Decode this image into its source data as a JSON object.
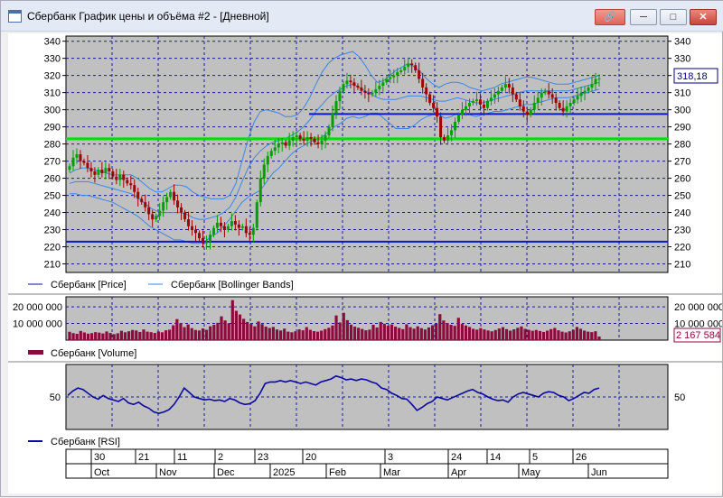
{
  "window": {
    "title": "Сбербанк График цены и объёма #2 - [Дневной]",
    "icons": [
      "app-icon",
      "link-icon",
      "minimize-icon",
      "maximize-icon",
      "close-icon"
    ]
  },
  "colors": {
    "background": "#c0c0c0",
    "grid": "#1a1aa0",
    "candle_up": "#00a000",
    "candle_down": "#a00000",
    "bands": "#3b86e8",
    "volume": "#8c0a3c",
    "rsi": "#0a0aa0",
    "support_green": "#00e000",
    "support_blue": "#0a18c8"
  },
  "chart_data": [
    {
      "type": "candlestick",
      "series": [
        {
          "name": "Сбербанк [Price]",
          "ohlc_close_values": [
            267,
            272,
            274,
            270,
            269,
            266,
            264,
            262,
            265,
            263,
            266,
            264,
            261,
            259,
            262,
            259,
            257,
            256,
            252,
            248,
            246,
            243,
            239,
            236,
            238,
            241,
            246,
            249,
            252,
            247,
            243,
            240,
            236,
            232,
            230,
            228,
            225,
            222,
            223,
            227,
            231,
            234,
            232,
            230,
            232,
            235,
            233,
            231,
            232,
            228,
            227,
            231,
            246,
            260,
            268,
            273,
            276,
            278,
            280,
            281,
            279,
            282,
            284,
            285,
            283,
            282,
            284,
            283,
            281,
            280,
            282,
            285,
            290,
            298,
            305,
            311,
            315,
            317,
            316,
            314,
            313,
            311,
            310,
            309,
            310,
            312,
            314,
            316,
            318,
            319,
            320,
            322,
            323,
            325,
            327,
            326,
            323,
            318,
            313,
            309,
            304,
            301,
            296,
            284,
            282,
            285,
            288,
            293,
            297,
            300,
            302,
            304,
            305,
            306,
            303,
            301,
            305,
            307,
            309,
            311,
            313,
            315,
            313,
            309,
            306,
            302,
            299,
            297,
            300,
            304,
            307,
            310,
            311,
            309,
            307,
            304,
            301,
            299,
            302,
            304,
            306,
            308,
            310,
            311,
            313,
            315,
            318,
            318.18
          ]
        },
        {
          "name": "Сбербанк [Bollinger Bands]",
          "upper": [
            263,
            265,
            266,
            266,
            265,
            264,
            263,
            262,
            262,
            262,
            262,
            260,
            257,
            254,
            252,
            252,
            254,
            256,
            256,
            255,
            252,
            250,
            249,
            248,
            248,
            248,
            250,
            257,
            270,
            283,
            293,
            299,
            300,
            299,
            298,
            296,
            296,
            297,
            301,
            307,
            315,
            322,
            327,
            330,
            332,
            333,
            334,
            331,
            326,
            320,
            316,
            317,
            320,
            323,
            325,
            327,
            325,
            322,
            318,
            315,
            313,
            315,
            316,
            316,
            315,
            313,
            312,
            311,
            312,
            313,
            315,
            316,
            317,
            318,
            319,
            319,
            318,
            317,
            316,
            315,
            315,
            315,
            316,
            317,
            318,
            319,
            320
          ],
          "middle": [
            257,
            258,
            258,
            258,
            257,
            256,
            255,
            254,
            253,
            252,
            251,
            249,
            246,
            243,
            241,
            240,
            240,
            240,
            240,
            239,
            237,
            236,
            236,
            237,
            238,
            240,
            243,
            249,
            258,
            266,
            272,
            276,
            279,
            281,
            282,
            283,
            285,
            287,
            290,
            294,
            299,
            303,
            307,
            310,
            312,
            314,
            315,
            313,
            311,
            309,
            307,
            306,
            306,
            306,
            307,
            308,
            308,
            308,
            307,
            306,
            305,
            305,
            306,
            307,
            306,
            305,
            304,
            304,
            305,
            306,
            307,
            308,
            309,
            310,
            311,
            311,
            311,
            311,
            311,
            311,
            311,
            311,
            312,
            313,
            314,
            315,
            316
          ],
          "lower": [
            251,
            251,
            250,
            250,
            249,
            248,
            247,
            246,
            244,
            242,
            240,
            238,
            235,
            232,
            230,
            228,
            226,
            224,
            224,
            223,
            222,
            222,
            223,
            226,
            228,
            232,
            236,
            241,
            246,
            249,
            251,
            253,
            258,
            263,
            266,
            270,
            274,
            277,
            279,
            281,
            283,
            284,
            287,
            290,
            292,
            295,
            296,
            295,
            296,
            298,
            298,
            295,
            292,
            289,
            289,
            289,
            291,
            294,
            296,
            297,
            297,
            295,
            296,
            298,
            297,
            297,
            296,
            297,
            298,
            299,
            299,
            300,
            301,
            302,
            303,
            303,
            304,
            305,
            306,
            307,
            307,
            307,
            308,
            309,
            310,
            311,
            312
          ]
        }
      ],
      "ylim": [
        205,
        343
      ],
      "y_ticks": [
        "340",
        "330",
        "320",
        "310",
        "300",
        "290",
        "280",
        "270",
        "260",
        "250",
        "240",
        "230",
        "220",
        "210"
      ],
      "last_value_label": "318,18",
      "horizontal_lines": [
        {
          "value": 283,
          "color": "#00e000"
        },
        {
          "value": 297.5,
          "color": "#0a18c8"
        },
        {
          "value": 223,
          "color": "#0a18c8"
        }
      ]
    },
    {
      "type": "bar",
      "series": [
        {
          "name": "Сбербанк [Volume]",
          "values": [
            5000000,
            4200000,
            3800000,
            5500000,
            4600000,
            3900000,
            4200000,
            4800000,
            4500000,
            4000000,
            5200000,
            4300000,
            3600000,
            4100000,
            5600000,
            4700000,
            5300000,
            6100000,
            5800000,
            4900000,
            6400000,
            5100000,
            4800000,
            4300000,
            5200000,
            4700000,
            5900000,
            6300000,
            8900000,
            12600000,
            10100000,
            7800000,
            9400000,
            7200000,
            6100000,
            5800000,
            7000000,
            6200000,
            8300000,
            9200000,
            10400000,
            14300000,
            11800000,
            10100000,
            24000000,
            17600000,
            15400000,
            12800000,
            10900000,
            9700000,
            8300000,
            11200000,
            9600000,
            8100000,
            7300000,
            7900000,
            6400000,
            5800000,
            6900000,
            5100000,
            4700000,
            5300000,
            6500000,
            5900000,
            7800000,
            6200000,
            5400000,
            5100000,
            5700000,
            6600000,
            7400000,
            8800000,
            14800000,
            10600000,
            16400000,
            12000000,
            9300000,
            8100000,
            7400000,
            6700000,
            5900000,
            6300000,
            9200000,
            7600000,
            10900000,
            9800000,
            8700000,
            9400000,
            8100000,
            7300000,
            6600000,
            9500000,
            7800000,
            6900000,
            8300000,
            7200000,
            6400000,
            7600000,
            8900000,
            9900000,
            15600000,
            11800000,
            10300000,
            9200000,
            8600000,
            13400000,
            9700000,
            8800000,
            7900000,
            6800000,
            6300000,
            7200000,
            6400000,
            5800000,
            5300000,
            6100000,
            7000000,
            7800000,
            6600000,
            5700000,
            6500000,
            7400000,
            8200000,
            6800000,
            6200000,
            5600000,
            6100000,
            5500000,
            4900000,
            5700000,
            6600000,
            7300000,
            5900000,
            5100000,
            4600000,
            5300000,
            6200000,
            7900000,
            6800000,
            5700000,
            5100000,
            4800000,
            5300000,
            2167584
          ]
        }
      ],
      "ylim": [
        0,
        26000000
      ],
      "y_ticks": [
        "20 000 000",
        "10 000 000"
      ],
      "last_value_label": "2 167 584"
    },
    {
      "type": "line",
      "series": [
        {
          "name": "Сбербанк [RSI]",
          "values": [
            52,
            58,
            62,
            60,
            55,
            50,
            47,
            52,
            48,
            46,
            44,
            48,
            42,
            40,
            43,
            38,
            35,
            30,
            28,
            30,
            33,
            40,
            50,
            62,
            56,
            50,
            48,
            46,
            47,
            45,
            46,
            44,
            48,
            46,
            42,
            40,
            41,
            45,
            55,
            68,
            70,
            70,
            72,
            70,
            72,
            70,
            68,
            70,
            68,
            66,
            70,
            72,
            74,
            78,
            76,
            73,
            74,
            72,
            74,
            73,
            70,
            68,
            62,
            60,
            55,
            52,
            48,
            47,
            40,
            32,
            36,
            41,
            44,
            50,
            48,
            46,
            49,
            52,
            55,
            58,
            60,
            56,
            54,
            50,
            47,
            45,
            46,
            43,
            50,
            54,
            56,
            54,
            52,
            50,
            55,
            57,
            56,
            52,
            50,
            45,
            48,
            52,
            56,
            55,
            60,
            62
          ]
        }
      ],
      "ylim": [
        0,
        100
      ],
      "y_ticks": [
        "50"
      ]
    }
  ],
  "x_axis": {
    "day_ticks": [
      "30",
      "21",
      "11",
      "2",
      "23",
      "20",
      "3",
      "24",
      "14",
      "5",
      "26"
    ],
    "month_labels": [
      "Oct",
      "Nov",
      "Dec",
      "2025",
      "Feb",
      "Mar",
      "Apr",
      "May",
      "Jun"
    ]
  }
}
